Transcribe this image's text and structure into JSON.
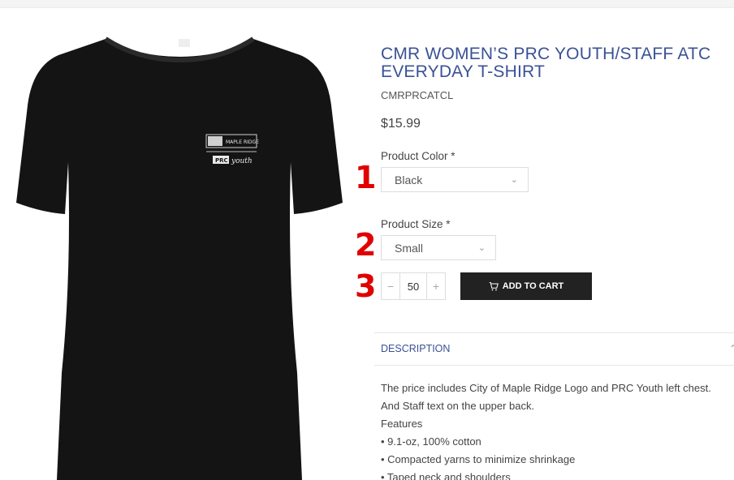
{
  "product": {
    "title": "CMR WOMEN’S PRC YOUTH/STAFF ATC EVERYDAY T-SHIRT",
    "sku": "CMRPRCATCL",
    "price": "$15.99",
    "image_logo_text": "MAPLE RIDGE",
    "image_badge_text": "PRC",
    "image_badge_text2": "youth"
  },
  "options": {
    "color_label": "Product Color *",
    "color_value": "Black",
    "size_label": "Product Size *",
    "size_value": "Small"
  },
  "quantity": {
    "minus": "−",
    "value": "50",
    "plus": "+"
  },
  "cart": {
    "label": "ADD TO CART"
  },
  "markers": [
    "1",
    "2",
    "3"
  ],
  "description": {
    "tab_label": "DESCRIPTION",
    "lines": [
      "The price includes City of Maple Ridge Logo and PRC Youth left chest.",
      "And Staff text on the upper back.",
      "Features",
      "• 9.1-oz, 100% cotton",
      "• Compacted yarns to minimize shrinkage",
      "• Taped neck and shoulders"
    ]
  },
  "colors": {
    "title": "#3a5196",
    "marker": "#e00000",
    "button_bg": "#222222",
    "shirt": "#141414"
  },
  "icons": {
    "cart": "cart-icon",
    "chevron": "chevron-down-icon"
  }
}
